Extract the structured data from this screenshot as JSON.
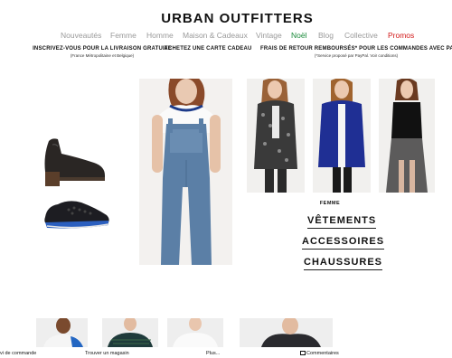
{
  "header": {
    "logo": "URBAN OUTFITTERS"
  },
  "nav": {
    "items": [
      {
        "label": "Nouveautés"
      },
      {
        "label": "Femme"
      },
      {
        "label": "Homme"
      },
      {
        "label": "Maison & Cadeaux"
      },
      {
        "label": "Vintage"
      },
      {
        "label": "Noël"
      },
      {
        "label": "Blog"
      },
      {
        "label": "Collective"
      },
      {
        "label": "Promos"
      }
    ],
    "colors": {
      "default": "#9a9a9a",
      "noel": "#1a8a3a",
      "promos": "#d21919"
    }
  },
  "promo": {
    "left": {
      "headline": "INSCRIVEZ-VOUS POUR LA LIVRAISON GRATUITE",
      "sub": "(France Métropolitaine et Belgique)"
    },
    "middle": {
      "headline": "ACHETEZ UNE CARTE CADEAU"
    },
    "right": {
      "headline": "FRAIS DE RETOUR REMBOURSÉS* POUR LES COMMANDES AVEC PAYPAL",
      "sub": "(*Service proposé par PayPal. Voir conditions)"
    }
  },
  "products": [
    {
      "icon": "platform-ankle-boot"
    },
    {
      "icon": "sneaker"
    },
    {
      "icon": "denim-overalls-model"
    },
    {
      "icon": "grey-cardigan-model"
    },
    {
      "icon": "blue-jacket-model"
    },
    {
      "icon": "black-sheer-dress-model"
    }
  ],
  "categories": {
    "heading": "FEMME",
    "links": [
      "VÊTEMENTS",
      "ACCESSOIRES",
      "CHAUSSURES"
    ]
  },
  "footer": {
    "links": [
      "vi de commande",
      "Trouver un magasin",
      "Plus...",
      "Commentaires"
    ]
  }
}
